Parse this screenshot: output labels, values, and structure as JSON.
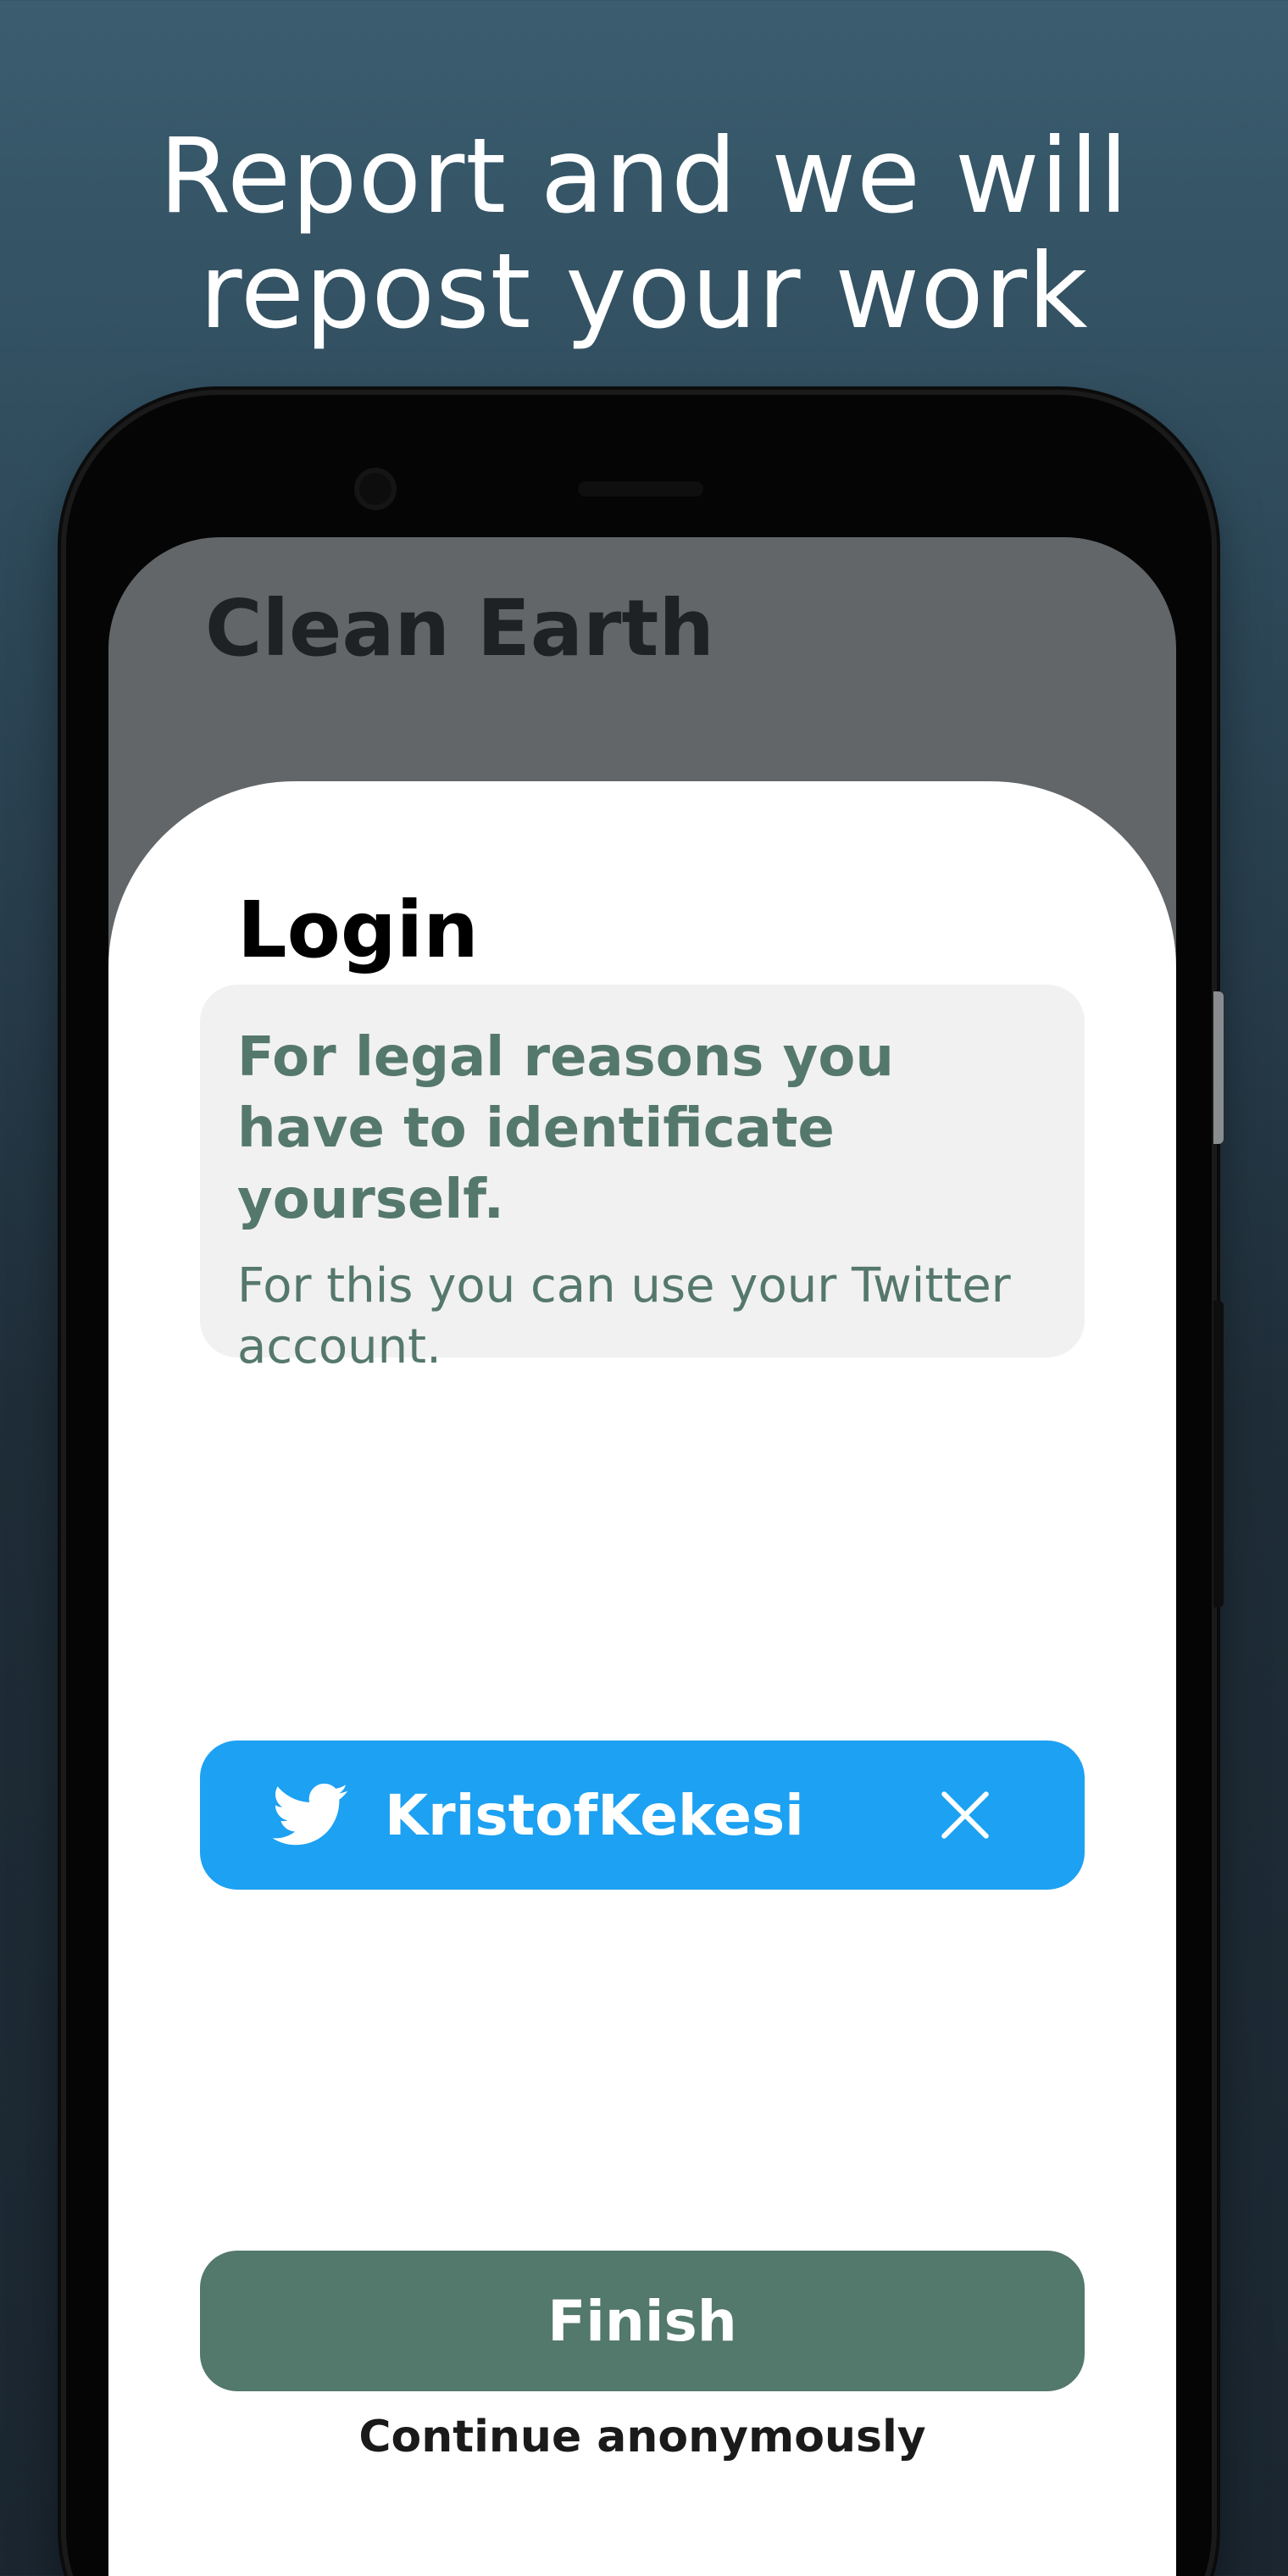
{
  "promo": {
    "headline_line1": "Report and we will",
    "headline_line2": "repost your work"
  },
  "app": {
    "title": "Clean Earth"
  },
  "login_sheet": {
    "title": "Login",
    "info_heading": "For legal reasons you have to identificate yourself.",
    "info_text": "For this you can use your Twitter account.",
    "twitter_account": {
      "icon": "twitter-bird-icon",
      "username": "KristofKekesi",
      "remove_icon": "close-icon"
    },
    "finish_label": "Finish",
    "continue_anonymously_label": "Continue anonymously"
  },
  "colors": {
    "background_top": "#3a5d6f",
    "background_bottom": "#1b2630",
    "app_bar": "#626668",
    "info_card": "#f1f1f1",
    "accent_green": "#53786c",
    "twitter_blue": "#1da1f2"
  }
}
